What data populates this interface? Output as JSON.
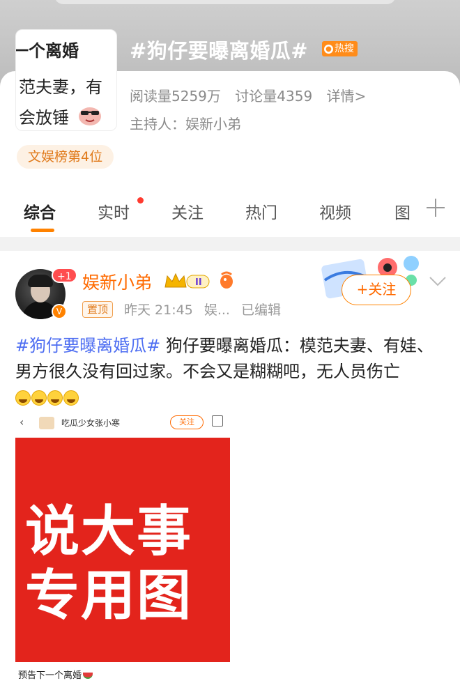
{
  "topic": {
    "title": "#狗仔要曝离婚瓜#",
    "hot_badge": "热搜",
    "read_count": "阅读量5259万",
    "discuss_count": "讨论量4359",
    "details_link": "详情>",
    "host": "主持人：娱新小弟",
    "rank": "文娱榜第4位",
    "cover_lines": [
      "一个离婚",
      "范夫妻，有",
      "会放锤"
    ]
  },
  "tabs": [
    {
      "label": "综合",
      "active": true
    },
    {
      "label": "实时",
      "has_dot": true
    },
    {
      "label": "关注"
    },
    {
      "label": "热门"
    },
    {
      "label": "视频"
    },
    {
      "label": "图"
    }
  ],
  "post": {
    "username": "娱新小弟",
    "plus_one": "+1",
    "pin_label": "置顶",
    "time": "昨天 21:45",
    "source": "娱...",
    "edited": "已编辑",
    "follow_label": "+关注",
    "hashtag": "#狗仔要曝离婚瓜#",
    "body": " 狗仔要曝离婚瓜：模范夫妻、有娃、男方很久没有回过家。不会又是糊糊吧，无人员伤亡",
    "emoji_icon": "laugh-cry-icon",
    "emoji_count": 4
  },
  "embed": {
    "account_name": "吃瓜少女张小寒",
    "follow_label": "关注",
    "image_text_line1": "说大事",
    "image_text_line2": "专用图",
    "caption": "预告下一个离婚"
  },
  "colors": {
    "accent": "#ff8200",
    "username": "#ff6a00",
    "hashtag": "#4e6ef2",
    "image_red": "#e3241c"
  }
}
